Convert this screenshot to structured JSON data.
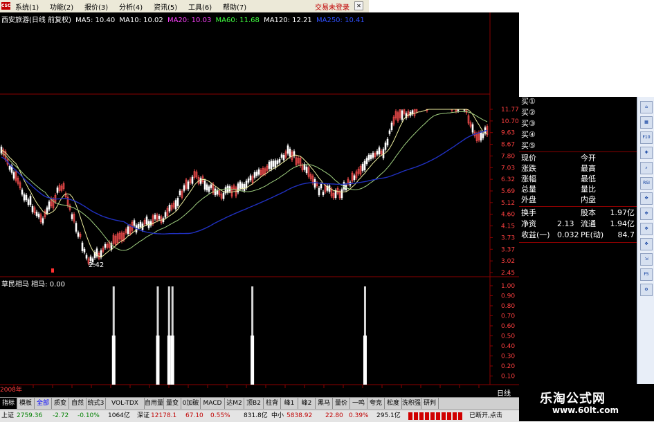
{
  "menubar": {
    "logo": "CSC",
    "items": [
      "系统(1)",
      "功能(2)",
      "报价(3)",
      "分析(4)",
      "资讯(5)",
      "工具(6)",
      "帮助(7)"
    ],
    "trade_status": "交易未登录"
  },
  "chart": {
    "header": {
      "stock": "西安旅游(日线 前复权)",
      "ma5": "MA5: 10.40",
      "ma10": "MA10: 10.02",
      "ma20": "MA20: 10.03",
      "ma60": "MA60: 11.68",
      "ma120": "MA120: 12.21",
      "ma250": "MA250: 10.41"
    },
    "price_axis": [
      "11.77",
      "10.70",
      "9.63",
      "8.67",
      "7.80",
      "7.03",
      "6.32",
      "5.69",
      "5.12",
      "4.60",
      "4.15",
      "3.73",
      "3.37",
      "3.02",
      "2.45"
    ],
    "low_marker": "2.42",
    "indicator_title": "草民相马  相马: 0.00",
    "indicator_axis": [
      "1.00",
      "0.90",
      "0.80",
      "0.70",
      "0.60",
      "0.50",
      "0.40",
      "0.30",
      "0.20",
      "0.10"
    ],
    "period_label": "日线",
    "year_label": "2008年",
    "signal_positions": [
      0.232,
      0.322,
      0.345,
      0.352,
      0.515,
      0.745
    ],
    "colors": {
      "price_up": "#ff5050",
      "price_down": "#ffffff",
      "ma_long": "#2030c0",
      "ma_mid": "#a0d080",
      "ma_short": "#f0f0a0",
      "grid": "#8b0000",
      "axis_text": "#ff4040"
    }
  },
  "quote_panel": {
    "buy_levels": [
      "买①",
      "买②",
      "买③",
      "买④",
      "买⑤"
    ],
    "rows": [
      {
        "l": "现价",
        "r": "今开"
      },
      {
        "l": "涨跌",
        "r": "最高"
      },
      {
        "l": "涨幅",
        "r": "最低"
      },
      {
        "l": "总量",
        "r": "量比"
      },
      {
        "l": "外盘",
        "r": "内盘"
      }
    ],
    "stats": [
      {
        "l": "换手",
        "m": "",
        "r": "股本",
        "v": "1.97亿"
      },
      {
        "l": "净资",
        "m": "2.13",
        "r": "流通",
        "v": "1.94亿"
      },
      {
        "l": "收益(一)",
        "m": "0.032",
        "r": "PE(动)",
        "v": "84.7"
      }
    ]
  },
  "toolbar_icons": [
    "home-icon",
    "chart-icon",
    "f10-icon",
    "crosshair-icon",
    "search-icon",
    "rsi-icon",
    "move-icon",
    "move-icon",
    "move-icon",
    "move-icon",
    "expand-icon",
    "f5-icon",
    "settings-icon"
  ],
  "toolbar_labels": [
    "⌂",
    "▦",
    "F10",
    "✚",
    "⌕",
    "RSI",
    "✥",
    "✥",
    "✥",
    "✥",
    "⇲",
    "F5",
    "⚙"
  ],
  "tabs": [
    "指标",
    "模板",
    "全部",
    "质变",
    "自然",
    "统式3",
    "VOL-TDX",
    "自用量",
    "量变",
    "0加破",
    "MACD",
    "达M2",
    "顶B2",
    "柱背",
    "峰1",
    "峰2",
    "黑马",
    "量价",
    "一鸣",
    "夸克",
    "松度",
    "洗积强",
    "研判"
  ],
  "ticker": {
    "sh_label": "上证",
    "sh_value": "2759.36",
    "sh_change": "-2.72",
    "sh_pct": "-0.10%",
    "sh_amount": "1064亿",
    "sz_label": "深证",
    "sz_value": "12178.1",
    "sz_change": "67.10",
    "sz_pct": "0.55%",
    "sz_amount": "831.8亿",
    "zx_label": "中小",
    "zx_value": "5838.92",
    "zx_change": "22.80",
    "zx_pct": "0.39%",
    "zx_amount": "295.1亿",
    "status": "已断开,点击"
  },
  "brand": {
    "title": "乐淘公式网",
    "url": "www.60lt.com"
  }
}
